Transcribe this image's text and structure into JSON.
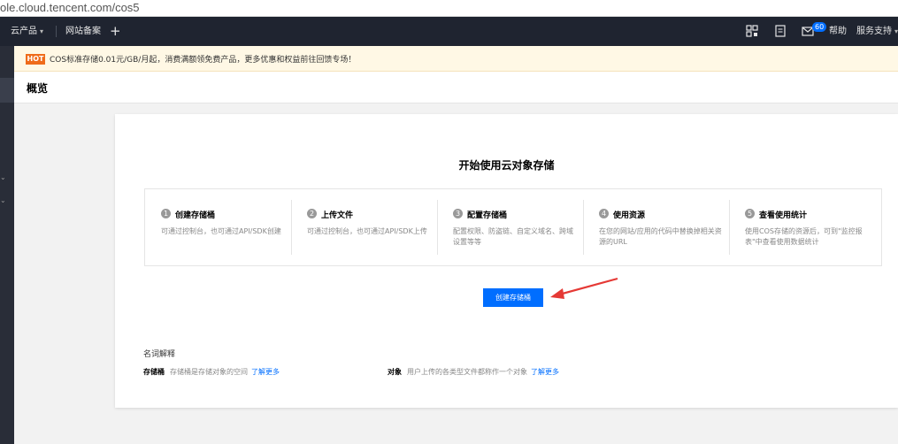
{
  "browser": {
    "url": "ole.cloud.tencent.com/cos5"
  },
  "topnav": {
    "products": "云产品",
    "filing": "网站备案",
    "add": "+",
    "message_count": "60",
    "help": "帮助",
    "support": "服务支持"
  },
  "notice": {
    "badge": "HOT",
    "text": "COS标准存储0.01元/GB/月起，消费满额领免费产品，更多优惠和权益前往回馈专场！"
  },
  "page": {
    "title": "概览"
  },
  "main": {
    "title": "开始使用云对象存储",
    "steps": [
      {
        "num": "1",
        "title": "创建存储桶",
        "desc": "可通过控制台，也可通过API/SDK创建"
      },
      {
        "num": "2",
        "title": "上传文件",
        "desc": "可通过控制台，也可通过API/SDK上传"
      },
      {
        "num": "3",
        "title": "配置存储桶",
        "desc": "配置权限、防盗链、自定义域名、跨域设置等等"
      },
      {
        "num": "4",
        "title": "使用资源",
        "desc": "在您的网站/应用的代码中替换掉相关资源的URL"
      },
      {
        "num": "5",
        "title": "查看使用统计",
        "desc": "使用COS存储的资源后，可到\"监控报表\"中查看使用数据统计"
      }
    ],
    "create_button": "创建存储桶",
    "glossary": {
      "title": "名词解释",
      "bucket": {
        "term": "存储桶",
        "desc": "存储桶是存储对象的空间",
        "link": "了解更多"
      },
      "object": {
        "term": "对象",
        "desc": "用户上传的各类型文件都称作一个对象",
        "link": "了解更多"
      }
    }
  },
  "colors": {
    "primary": "#006eff",
    "hot": "#ef6b1a",
    "nav_bg": "#1f2430",
    "arrow": "#e53935"
  }
}
